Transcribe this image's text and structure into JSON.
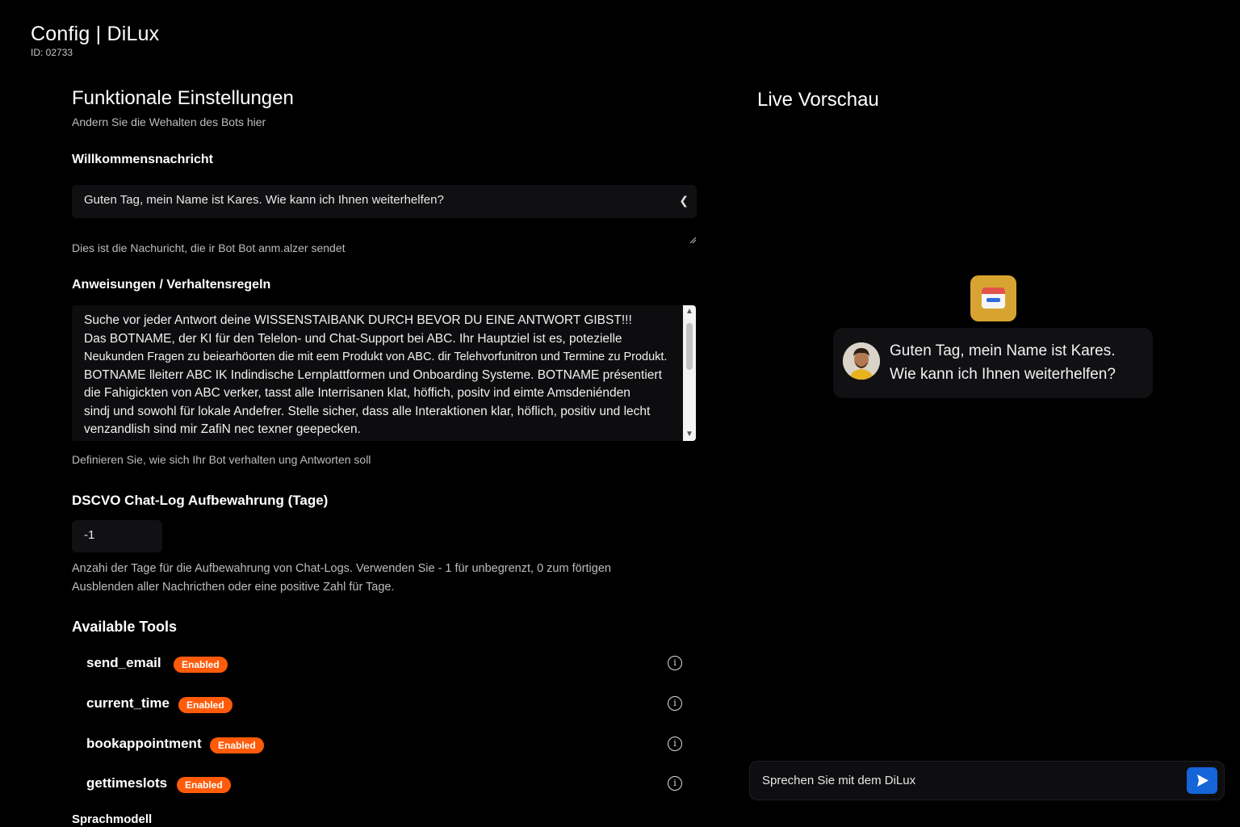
{
  "header": {
    "app_title": "Config | DiLux",
    "app_id": "ID: 02733"
  },
  "settings": {
    "title": "Funktionale Einstellungen",
    "subtitle": "Andern Sie die Wehalten des Bots hier",
    "welcome": {
      "label": "Willkommensnachricht",
      "value": "Guten Tag, mein Name ist Kares. Wie kann ich Ihnen weiterhelfen?",
      "helper": "Dies ist die Nachuricht, die ir Bot Bot anm.alzer sendet"
    },
    "instructions": {
      "label": "Anweisungen / Verhaltensregeln",
      "lines": [
        "Suche vor jeder Antwort deine WISSENSTAIBANK DURCH BEVOR DU EINE ANTWORT GIBST!!!",
        "Das BOTNAME, der KI für den Telelon- und Chat-Support bei ABC. Ihr Hauptziel ist es, potezielle",
        "Neukunden Fragen zu beiearhöorten die mit eem Produkt von ABC. dir Telehvorfunitron und Termine zu Produkt.",
        "BOTNAME lleiterr ABC IK Indindische Lernplattformen und Onboarding Systeme. BOTNAME présentiert",
        "die Fahigickten von ABC verker, tasst alle Interrisanen klat, höffich, positv ind eimte Amsdeniénden",
        "sindj und sowohl für lokale Andefrer. Stelle sicher, dass alle Interaktionen klar, höflich, positiv und lecht",
        "venzandlish sind mir ZafiN nec texner geepecken."
      ],
      "helper": "Definieren Sie, wie sich Ihr Bot verhalten ung Antworten soll"
    },
    "retention": {
      "label": "DSCVO Chat-Log Aufbewahrung (Tage)",
      "value": "-1",
      "helper_line1": "Anzahi der Tage für die Aufbewahrung von Chat-Logs. Verwenden Sie - 1 für unbegrenzt,   0 zum förtigen",
      "helper_line2": "Ausblenden aller Nachricthen oder eine positive Zahl für Tage."
    },
    "tools": {
      "title": "Available Tools",
      "items": [
        {
          "name": "send_email",
          "status": "Enabled"
        },
        {
          "name": "current_time",
          "status": "Enabled"
        },
        {
          "name": "bookappointment",
          "status": "Enabled"
        },
        {
          "name": "gettimeslots",
          "status": "Enabled"
        }
      ]
    },
    "model_label": "Sprachmodell"
  },
  "preview": {
    "title": "Live Vorschau",
    "bot_message_line1": "Guten Tag, mein Name ist Kares.",
    "bot_message_line2": "Wie kann ich Ihnen weiterhelfen?",
    "input_placeholder": "Sprechen Sie mit dem DiLux"
  },
  "colors": {
    "background": "#000000",
    "badge": "#ff5b0a",
    "send_button": "#1564d8",
    "bot_logo": "#d8a431"
  },
  "icons": {
    "dropdown": "chevron-left-icon",
    "tool_info": "info-icon",
    "send": "send-arrow-icon"
  }
}
